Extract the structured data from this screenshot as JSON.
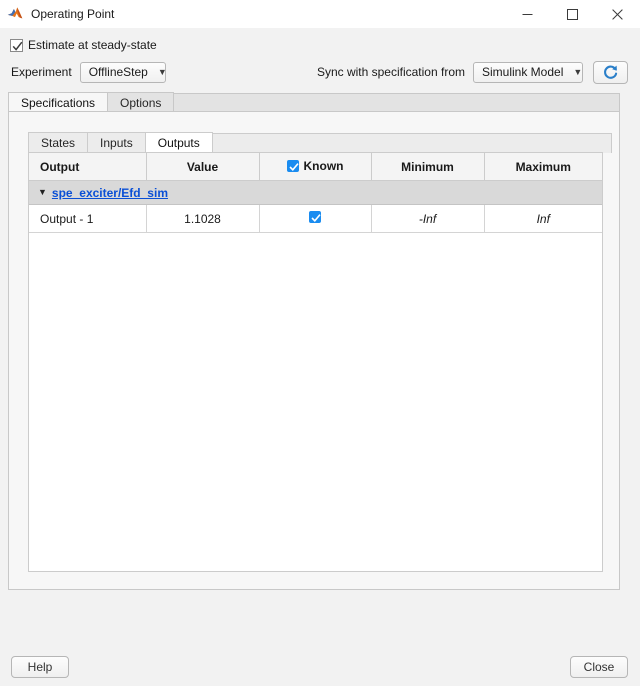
{
  "window": {
    "title": "Operating Point",
    "logo_icon": "matlab-membrane-icon",
    "minimize_icon": "minimize-icon",
    "maximize_icon": "maximize-icon",
    "close_icon": "close-icon"
  },
  "steady_state": {
    "label": "Estimate at steady-state",
    "checked": true
  },
  "experiment": {
    "label": "Experiment",
    "value": "OfflineStep",
    "options": [
      "OfflineStep"
    ],
    "arrow_icon": "chevron-down-icon"
  },
  "sync": {
    "label": "Sync with specification from",
    "value": "Simulink Model",
    "options": [
      "Simulink Model"
    ],
    "arrow_icon": "chevron-down-icon",
    "refresh_icon": "refresh-icon",
    "refresh_color": "#1f6fc4"
  },
  "outer_tabs": [
    {
      "label": "Specifications",
      "active": true
    },
    {
      "label": "Options",
      "active": false
    }
  ],
  "inner_tabs": [
    {
      "label": "States",
      "active": false
    },
    {
      "label": "Inputs",
      "active": false
    },
    {
      "label": "Outputs",
      "active": true
    }
  ],
  "table": {
    "columns": [
      {
        "label": "Output",
        "align": "left"
      },
      {
        "label": "Value",
        "align": "center"
      },
      {
        "label": "Known",
        "align": "center",
        "has_checkbox": true,
        "checked": true
      },
      {
        "label": "Minimum",
        "align": "center"
      },
      {
        "label": "Maximum",
        "align": "center"
      }
    ],
    "groups": [
      {
        "link": "spe_exciter/Efd_sim",
        "expanded": true,
        "expander_icon": "triangle-down-icon",
        "rows": [
          {
            "output": "Output - 1",
            "value": "1.1028",
            "known": true,
            "minimum": "-Inf",
            "maximum": "Inf"
          }
        ]
      }
    ]
  },
  "footer": {
    "help_label": "Help",
    "close_label": "Close"
  },
  "colors": {
    "accent_blue": "#1a8cf0",
    "link_blue": "#0a4fd6",
    "titlebar_bg": "#ffffff",
    "body_bg": "#f2f2f2",
    "group_row_bg": "#d9d9d9"
  }
}
